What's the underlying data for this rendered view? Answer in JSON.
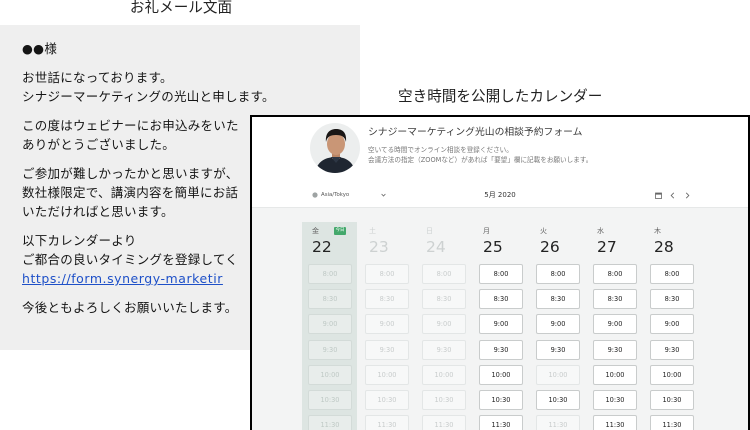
{
  "email": {
    "heading": "お礼メール文面",
    "greeting": "●●様",
    "paragraphs": [
      [
        "お世話になっております。",
        "シナジーマーケティングの光山と申します。"
      ],
      [
        "この度はウェビナーにお申込みをいた",
        "ありがとうございました。"
      ],
      [
        "ご参加が難しかったかと思いますが、",
        "数社様限定で、講演内容を簡単にお話",
        "いただければと思います。"
      ],
      [
        "以下カレンダーより",
        "ご都合の良いタイミングを登録してく"
      ],
      [
        "今後ともよろしくお願いいたします。"
      ]
    ],
    "link": "https://form.synergy-marketir"
  },
  "calendar_caption": "空き時間を公開したカレンダー",
  "calendar": {
    "form_title": "シナジーマーケティング光山の相談予約フォーム",
    "description": [
      "空いてる時間でオンライン相談を登録ください。",
      "会議方法の指定（ZOOMなど）があれば「要望」欄に記載をお願いします。"
    ],
    "timezone": "Asia/Tokyo",
    "month_label": "5月 2020",
    "today_badge": "今日",
    "days": [
      {
        "weekday": "金",
        "date": "22",
        "today": true,
        "open": true,
        "slots": [
          {
            "time": "8:00",
            "available": false
          },
          {
            "time": "8:30",
            "available": false
          },
          {
            "time": "9:00",
            "available": false
          },
          {
            "time": "9:30",
            "available": false
          },
          {
            "time": "10:00",
            "available": false
          },
          {
            "time": "10:30",
            "available": false
          },
          {
            "time": "11:30",
            "available": false
          }
        ]
      },
      {
        "weekday": "土",
        "date": "23",
        "today": false,
        "open": false,
        "slots": [
          {
            "time": "8:00",
            "available": false
          },
          {
            "time": "8:30",
            "available": false
          },
          {
            "time": "9:00",
            "available": false
          },
          {
            "time": "9:30",
            "available": false
          },
          {
            "time": "10:00",
            "available": false
          },
          {
            "time": "10:30",
            "available": false
          },
          {
            "time": "11:30",
            "available": false
          }
        ]
      },
      {
        "weekday": "日",
        "date": "24",
        "today": false,
        "open": false,
        "slots": [
          {
            "time": "8:00",
            "available": false
          },
          {
            "time": "8:30",
            "available": false
          },
          {
            "time": "9:00",
            "available": false
          },
          {
            "time": "9:30",
            "available": false
          },
          {
            "time": "10:00",
            "available": false
          },
          {
            "time": "10:30",
            "available": false
          },
          {
            "time": "11:30",
            "available": false
          }
        ]
      },
      {
        "weekday": "月",
        "date": "25",
        "today": false,
        "open": true,
        "slots": [
          {
            "time": "8:00",
            "available": true
          },
          {
            "time": "8:30",
            "available": true
          },
          {
            "time": "9:00",
            "available": true
          },
          {
            "time": "9:30",
            "available": true
          },
          {
            "time": "10:00",
            "available": true
          },
          {
            "time": "10:30",
            "available": true
          },
          {
            "time": "11:30",
            "available": true
          }
        ]
      },
      {
        "weekday": "火",
        "date": "26",
        "today": false,
        "open": true,
        "slots": [
          {
            "time": "8:00",
            "available": true
          },
          {
            "time": "8:30",
            "available": true
          },
          {
            "time": "9:00",
            "available": true
          },
          {
            "time": "9:30",
            "available": true
          },
          {
            "time": "10:00",
            "available": false
          },
          {
            "time": "10:30",
            "available": true
          },
          {
            "time": "11:30",
            "available": false
          }
        ]
      },
      {
        "weekday": "水",
        "date": "27",
        "today": false,
        "open": true,
        "slots": [
          {
            "time": "8:00",
            "available": true
          },
          {
            "time": "8:30",
            "available": true
          },
          {
            "time": "9:00",
            "available": true
          },
          {
            "time": "9:30",
            "available": true
          },
          {
            "time": "10:00",
            "available": true
          },
          {
            "time": "10:30",
            "available": true
          },
          {
            "time": "11:30",
            "available": true
          }
        ]
      },
      {
        "weekday": "木",
        "date": "28",
        "today": false,
        "open": true,
        "slots": [
          {
            "time": "8:00",
            "available": true
          },
          {
            "time": "8:30",
            "available": true
          },
          {
            "time": "9:00",
            "available": true
          },
          {
            "time": "9:30",
            "available": true
          },
          {
            "time": "10:00",
            "available": true
          },
          {
            "time": "10:30",
            "available": true
          },
          {
            "time": "11:30",
            "available": true
          }
        ]
      }
    ]
  },
  "icons": {
    "timezone": "globe-icon",
    "timezone_dropdown": "chevron-down-icon",
    "date_picker": "calendar-icon",
    "previous_week": "chevron-left-icon",
    "next_week": "chevron-right-icon"
  },
  "colors": {
    "panel_background": "#efefef",
    "link": "#1e50c8",
    "today_badge": "#43a86b",
    "today_column": "#dde5e2",
    "frame_border": "#000000"
  }
}
